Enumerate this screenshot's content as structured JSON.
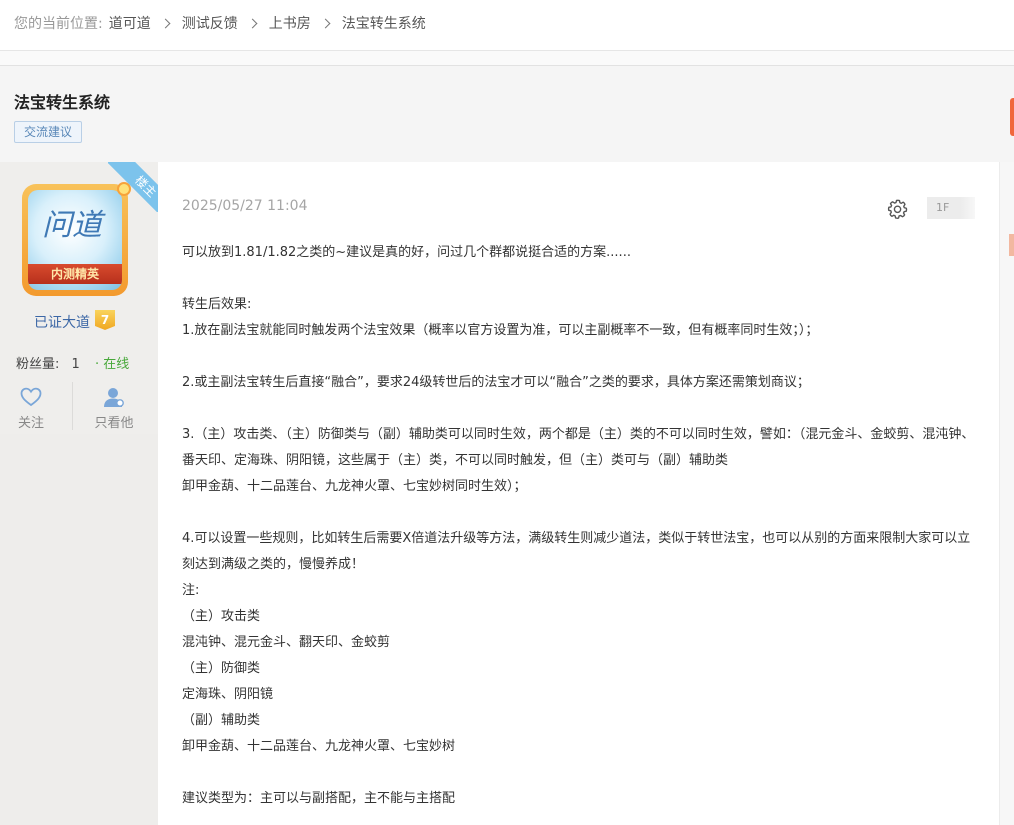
{
  "breadcrumb": {
    "lead": "您的当前位置:",
    "items": [
      "道可道",
      "测试反馈",
      "上书房",
      "法宝转生系统"
    ]
  },
  "thread": {
    "title": "法宝转生系统",
    "tag": "交流建议"
  },
  "author": {
    "badge": "楼主",
    "avatar_text": "问道",
    "avatar_ribbon": "内测精英",
    "name": "已证大道",
    "level": "7",
    "fans_label": "粉丝量:",
    "fans_count": "1",
    "status": "· 在线",
    "actions": {
      "follow": "关注",
      "only_author": "只看他"
    }
  },
  "post": {
    "datetime": "2025/05/27 11:04",
    "floor": "1F",
    "lines": [
      "可以放到1.81/1.82之类的~建议是真的好，问过几个群都说挺合适的方案......",
      "",
      "转生后效果:",
      "1.放在副法宝就能同时触发两个法宝效果（概率以官方设置为准，可以主副概率不一致，但有概率同时生效；）；",
      "",
      "2.或主副法宝转生后直接“融合”，要求24级转世后的法宝才可以“融合”之类的要求，具体方案还需策划商议；",
      "",
      "3.（主）攻击类、（主）防御类与（副）辅助类可以同时生效，两个都是（主）类的不可以同时生效，譬如：（混元金斗、金蛟剪、混沌钟、番天印、定海珠、阴阳镜，这些属于（主）类，不可以同时触发，但（主）类可与（副）辅助类",
      "卸甲金葫、十二品莲台、九龙神火罩、七宝妙树同时生效）；",
      "",
      "4.可以设置一些规则，比如转生后需要X倍道法升级等方法，满级转生则减少道法，类似于转世法宝，也可以从别的方面来限制大家可以立刻达到满级之类的，慢慢养成！",
      "注:",
      "（主）攻击类",
      "混沌钟、混元金斗、翻天印、金蛟剪",
      "（主）防御类",
      "定海珠、阴阳镜",
      "（副）辅助类",
      "卸甲金葫、十二品莲台、九龙神火罩、七宝妙树",
      "",
      "建议类型为：主可以与副搭配，主不能与主搭配"
    ]
  },
  "colors": {
    "accent_blue": "#3c67a6",
    "online_green": "#48a83a",
    "ribbon_blue": "#7cc3ec",
    "edge_orange": "#f0673c"
  },
  "icons": {
    "follow": "heart-outline-icon",
    "only_author": "user-icon",
    "settings": "gear-icon",
    "breadcrumb_separator": "chevron-right-icon"
  }
}
